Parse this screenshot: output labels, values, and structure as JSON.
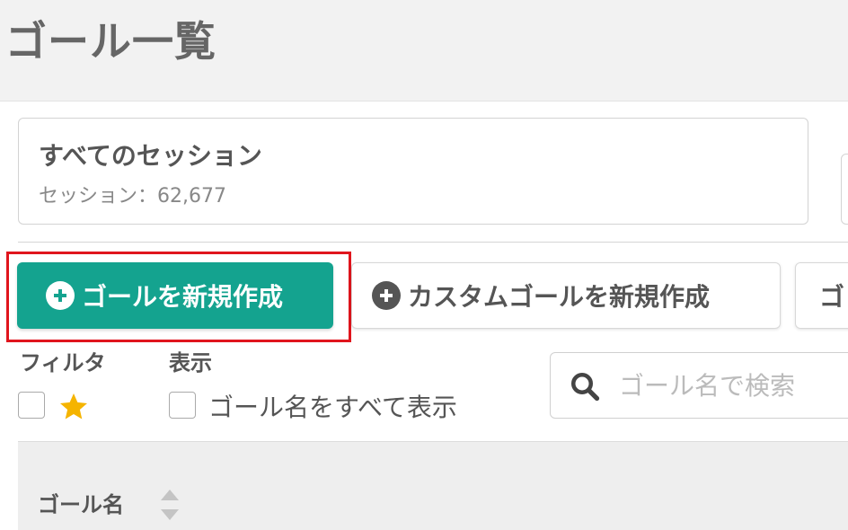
{
  "page": {
    "title": "ゴール一覧"
  },
  "segment": {
    "title": "すべてのセッション",
    "sessions": "セッション：62,677"
  },
  "toolbar": {
    "new_goal_label": "ゴールを新規作成",
    "new_custom_goal_label": "カスタムゴールを新規作成",
    "third_button_label": "ゴ"
  },
  "filters": {
    "filter_label": "フィルタ",
    "display_label": "表示",
    "show_all_names_label": "ゴール名をすべて表示",
    "star_checked": false,
    "show_all_checked": false
  },
  "search": {
    "placeholder": "ゴール名で検索",
    "value": ""
  },
  "table": {
    "columns": [
      "ゴール名"
    ]
  },
  "colors": {
    "primary": "#14a38f",
    "highlight": "#e0151d",
    "star": "#f5b400"
  }
}
